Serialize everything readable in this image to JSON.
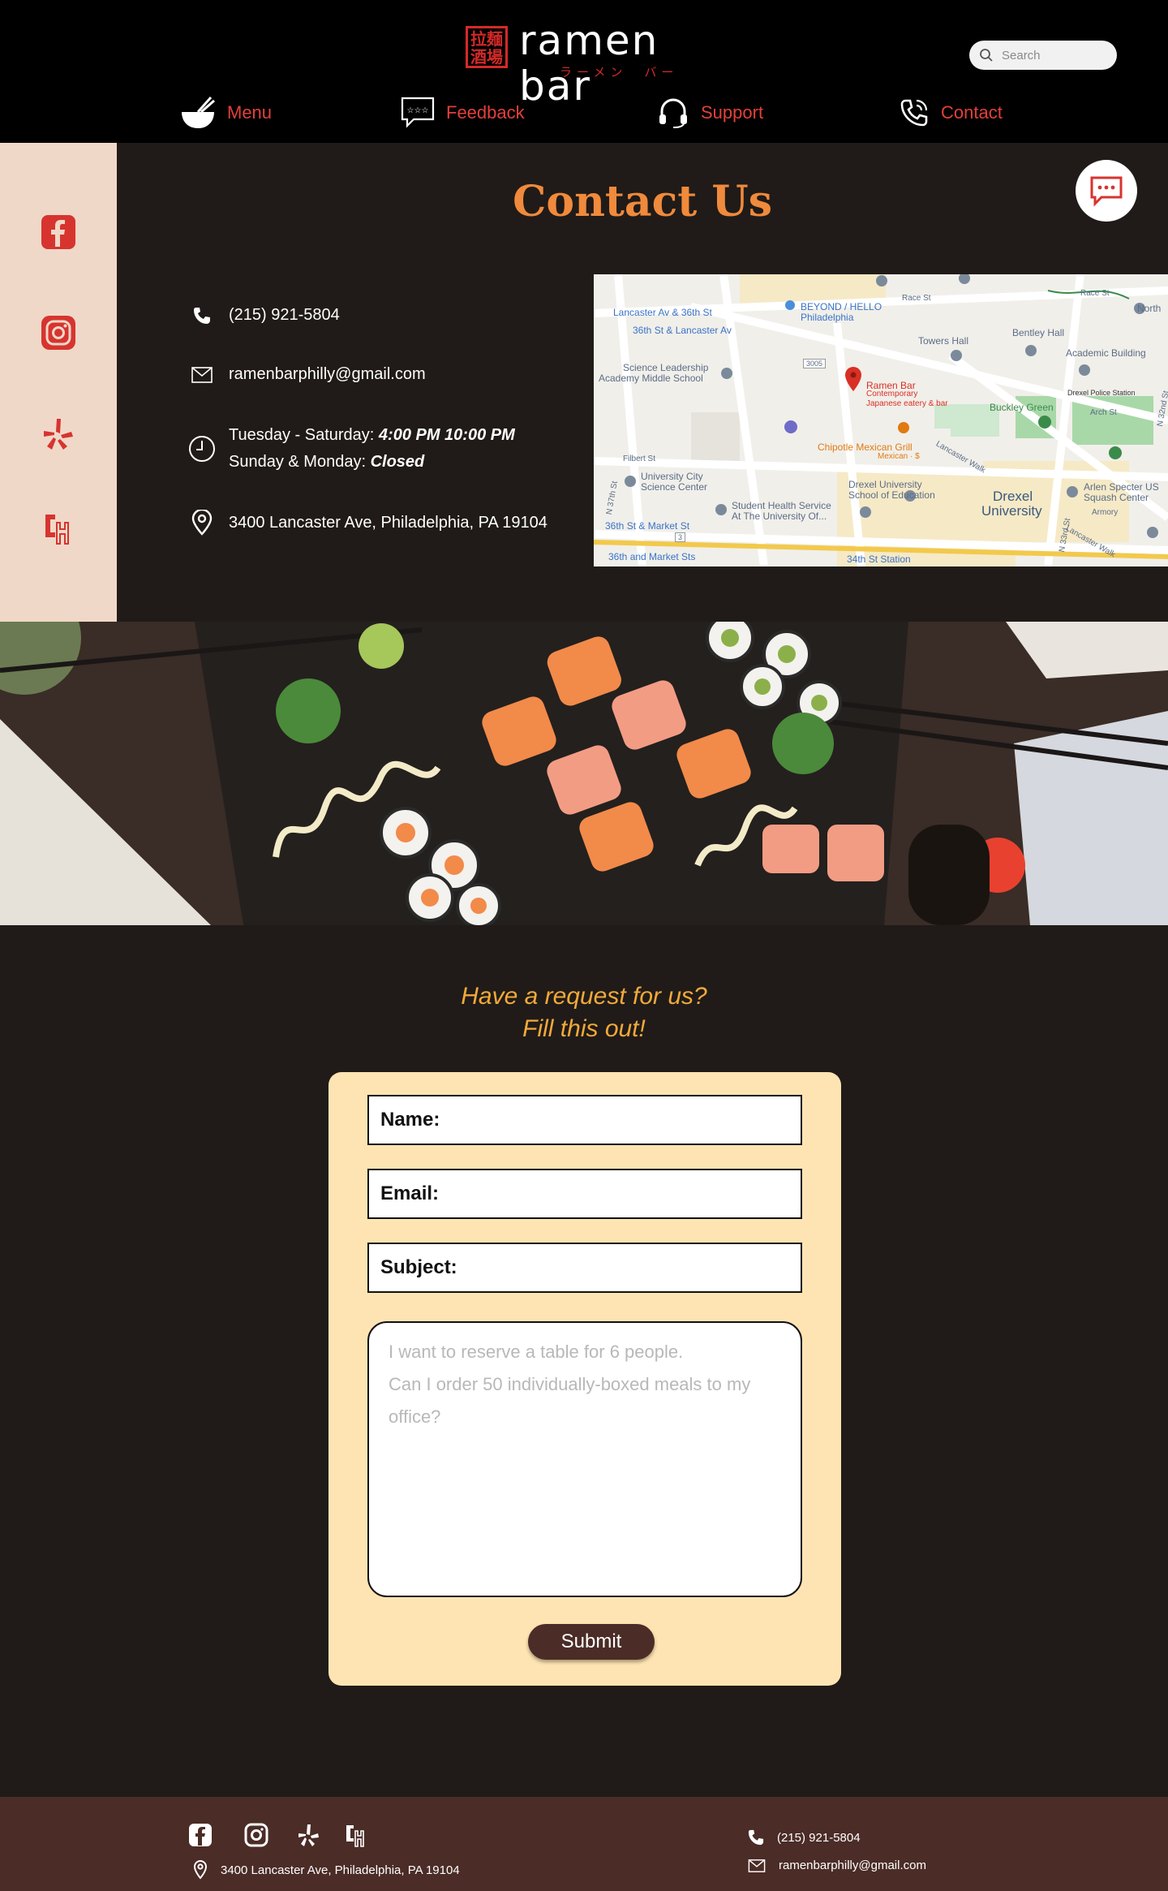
{
  "header": {
    "logo_seal": "拉麺酒場",
    "logo_text": "ramen bar",
    "logo_sub": "ラーメン　バー",
    "search_placeholder": "Search"
  },
  "nav": [
    {
      "label": "Menu",
      "icon": "ramen-bowl-icon"
    },
    {
      "label": "Feedback",
      "icon": "feedback-stars-icon"
    },
    {
      "label": "Support",
      "icon": "headset-icon"
    },
    {
      "label": "Contact",
      "icon": "phone-icon"
    }
  ],
  "sidebar": [
    "facebook-icon",
    "instagram-icon",
    "yelp-icon",
    "grubhub-icon"
  ],
  "contact": {
    "title": "Contact Us",
    "phone": "(215) 921-5804",
    "email": "ramenbarphilly@gmail.com",
    "hours_line1_prefix": "Tuesday - Saturday: ",
    "hours_line1_time": "4:00 PM  10:00 PM",
    "hours_line2_prefix": "Sunday & Monday: ",
    "hours_line2_value": "Closed",
    "address": "3400 Lancaster Ave, Philadelphia, PA 19104"
  },
  "map": {
    "labels": {
      "lancaster36": "Lancaster Av & 36th St",
      "st36lancaster": "36th St & Lancaster Av",
      "beyond": "BEYOND / HELLO",
      "beyond2": "Philadelphia",
      "race": "Race St",
      "race2": "Race St",
      "towers": "Towers Hall",
      "bentley": "Bentley Hall",
      "north": "North",
      "academic": "Academic Building",
      "police": "Drexel Police Station",
      "science": "Science Leadership",
      "science2": "Academy Middle School",
      "ramen": "Ramen Bar",
      "ramen2": "Contemporary",
      "ramen3": "Japanese eatery & bar",
      "buckley": "Buckley Green",
      "arch": "Arch St",
      "chipotle": "Chipotle Mexican Grill",
      "chipotle2": "Mexican · $",
      "filbert": "Filbert St",
      "ucsc": "University City",
      "ucsc2": "Science Center",
      "shs": "Student Health Service",
      "shs2": "At The University Of...",
      "drexel_edu": "Drexel University",
      "drexel_edu2": "School of Education",
      "drexel": "Drexel",
      "drexel2": "University",
      "arlen": "Arlen Specter US",
      "arlen2": "Squash Center",
      "armory": "Armory",
      "market36": "36th St & Market St",
      "market36b": "36th and Market Sts",
      "st34": "34th St Station",
      "n37": "N 37th St",
      "n33": "N 33rd St",
      "n32": "N 32nd St",
      "lancwalk": "Lancaster Walk",
      "lancwalk2": "Lancaster Walk",
      "rt3005": "3005",
      "rt3": "3"
    }
  },
  "form": {
    "heading_line1": "Have a request for us?",
    "heading_line2": "Fill this out!",
    "name_label": "Name:",
    "email_label": "Email:",
    "subject_label": "Subject:",
    "message_placeholder": "I want to reserve a table for 6 people.\nCan I order 50 individually-boxed meals to my office?",
    "submit_label": "Submit"
  },
  "footer": {
    "address": "3400 Lancaster Ave, Philadelphia, PA 19104",
    "phone": "(215) 921-5804",
    "email": "ramenbarphilly@gmail.com"
  },
  "colors": {
    "accent_red": "#e2403a",
    "title_orange": "#f08a3c",
    "heading_gold": "#f2a93b",
    "form_bg": "#ffe4b3",
    "footer_bg": "#4b2c27",
    "sidebar_bg": "#f0d8c8"
  }
}
